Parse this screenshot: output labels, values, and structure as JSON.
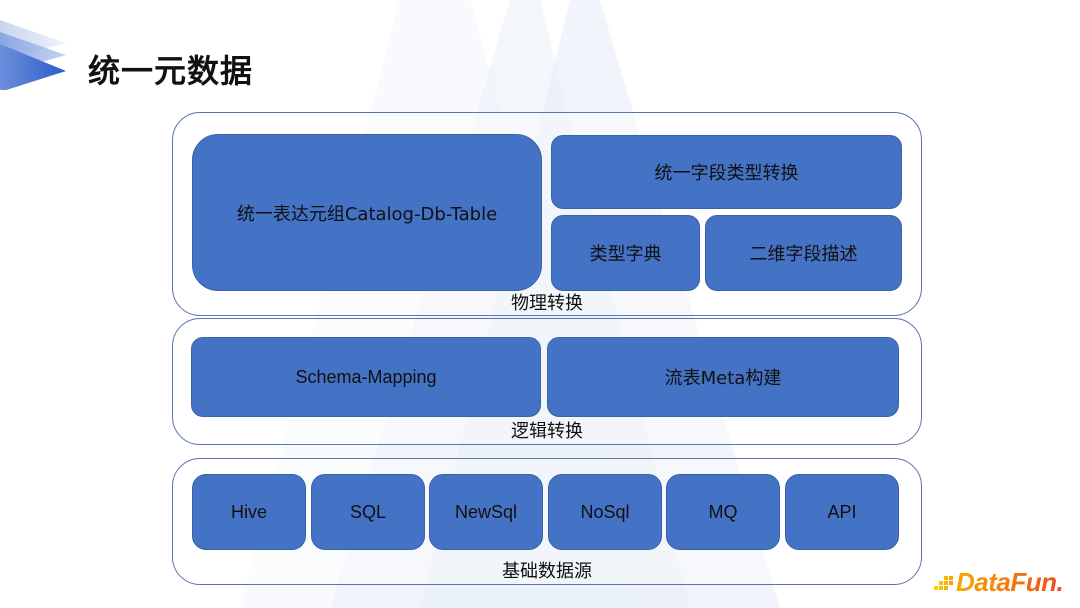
{
  "slide": {
    "title": "统一元数据",
    "colors": {
      "box_fill": "#4472c4",
      "group_border": "#5a74ad",
      "brand_start": "#f6a800",
      "brand_end": "#f04a1a"
    }
  },
  "layers": {
    "physical": {
      "label": "物理转换",
      "boxes": {
        "catalog": "统一表达元组Catalog-Db-Table",
        "field_type_conversion": "统一字段类型转换",
        "type_dictionary": "类型字典",
        "two_dim_field_desc": "二维字段描述"
      }
    },
    "logical": {
      "label": "逻辑转换",
      "boxes": {
        "schema_mapping": "Schema-Mapping",
        "stream_table_meta": "流表Meta构建"
      }
    },
    "datasource": {
      "label": "基础数据源",
      "sources": [
        "Hive",
        "SQL",
        "NewSql",
        "NoSql",
        "MQ",
        "API"
      ]
    }
  },
  "brand": {
    "name": "DataFun."
  }
}
